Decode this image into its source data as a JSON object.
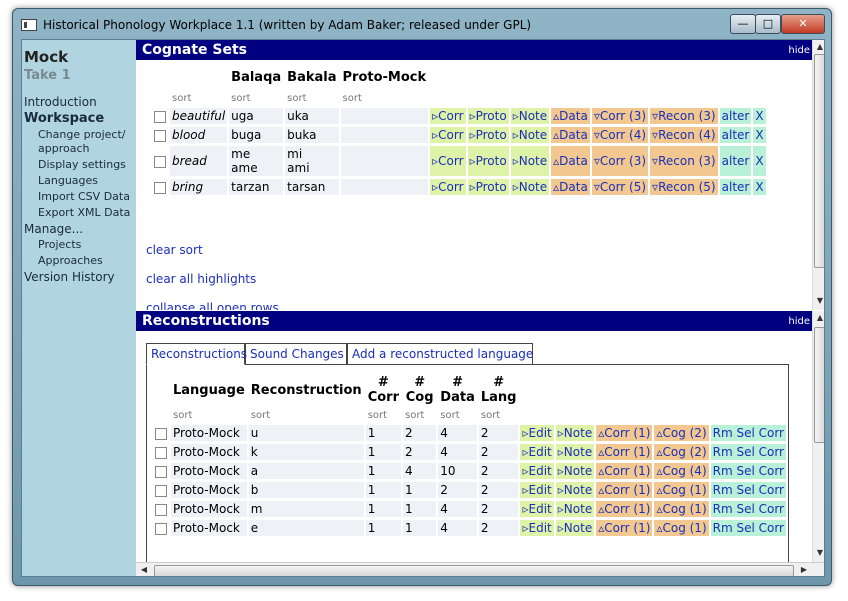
{
  "window": {
    "title": "Historical Phonology Workplace 1.1 (written by Adam Baker; released under GPL)",
    "minimize": "—",
    "maximize": "□",
    "close": "✕"
  },
  "sidebar": {
    "project_name": "Mock",
    "take": "Take 1",
    "introduction": "Introduction",
    "workspace": "Workspace",
    "workspace_items": [
      "Change project/",
      "approach",
      "Display settings",
      "Languages",
      "Import CSV Data",
      "Export XML Data"
    ],
    "manage": "Manage...",
    "manage_items": [
      "Projects",
      "Approaches"
    ],
    "version_history": "Version History"
  },
  "cognate_sets": {
    "header": "Cognate Sets",
    "hide": "hide",
    "columns": [
      "Balaqa",
      "Bakala",
      "Proto-Mock"
    ],
    "sort_label": "sort",
    "rows": [
      {
        "gloss": "beautiful",
        "balaqa": "uga",
        "bakala": "uka",
        "proto": "",
        "corr": "Corr",
        "proto_btn": "Proto",
        "note": "Note",
        "data": "Data",
        "corr_count": "Corr (3)",
        "recon": "Recon (3)",
        "alter": "alter",
        "x": "X"
      },
      {
        "gloss": "blood",
        "balaqa": "buga",
        "bakala": "buka",
        "proto": "",
        "corr": "Corr",
        "proto_btn": "Proto",
        "note": "Note",
        "data": "Data",
        "corr_count": "Corr (4)",
        "recon": "Recon (4)",
        "alter": "alter",
        "x": "X"
      },
      {
        "gloss": "bread",
        "balaqa": "me\name",
        "bakala": "mi\nami",
        "proto": "",
        "corr": "Corr",
        "proto_btn": "Proto",
        "note": "Note",
        "data": "Data",
        "corr_count": "Corr (3)",
        "recon": "Recon (3)",
        "alter": "alter",
        "x": "X"
      },
      {
        "gloss": "bring",
        "balaqa": "tarzan",
        "bakala": "tarsan",
        "proto": "",
        "corr": "Corr",
        "proto_btn": "Proto",
        "note": "Note",
        "data": "Data",
        "corr_count": "Corr (5)",
        "recon": "Recon (5)",
        "alter": "alter",
        "x": "X"
      }
    ],
    "clear_sort": "clear sort",
    "clear_highlights": "clear all highlights",
    "collapse_rows": "collapse all open rows"
  },
  "reconstructions": {
    "header": "Reconstructions",
    "hide": "hide",
    "tabs": [
      "Reconstructions",
      "Sound Changes",
      "Add a reconstructed language"
    ],
    "columns": {
      "language": "Language",
      "reconstruction": "Reconstruction",
      "corr": "#\nCorr",
      "cog": "#\nCog",
      "data": "#\nData",
      "lang": "#\nLang"
    },
    "sort_label": "sort",
    "rows": [
      {
        "language": "Proto-Mock",
        "recon": "u",
        "corr": "1",
        "cog": "2",
        "data": "4",
        "lang": "2",
        "edit": "Edit",
        "note": "Note",
        "corr_btn": "Corr (1)",
        "cog_btn": "Cog (2)",
        "rm": "Rm Sel Corr"
      },
      {
        "language": "Proto-Mock",
        "recon": "k",
        "corr": "1",
        "cog": "2",
        "data": "4",
        "lang": "2",
        "edit": "Edit",
        "note": "Note",
        "corr_btn": "Corr (1)",
        "cog_btn": "Cog (2)",
        "rm": "Rm Sel Corr"
      },
      {
        "language": "Proto-Mock",
        "recon": "a",
        "corr": "1",
        "cog": "4",
        "data": "10",
        "lang": "2",
        "edit": "Edit",
        "note": "Note",
        "corr_btn": "Corr (1)",
        "cog_btn": "Cog (4)",
        "rm": "Rm Sel Corr"
      },
      {
        "language": "Proto-Mock",
        "recon": "b",
        "corr": "1",
        "cog": "1",
        "data": "2",
        "lang": "2",
        "edit": "Edit",
        "note": "Note",
        "corr_btn": "Corr (1)",
        "cog_btn": "Cog (1)",
        "rm": "Rm Sel Corr"
      },
      {
        "language": "Proto-Mock",
        "recon": "m",
        "corr": "1",
        "cog": "1",
        "data": "4",
        "lang": "2",
        "edit": "Edit",
        "note": "Note",
        "corr_btn": "Corr (1)",
        "cog_btn": "Cog (1)",
        "rm": "Rm Sel Corr"
      },
      {
        "language": "Proto-Mock",
        "recon": "e",
        "corr": "1",
        "cog": "1",
        "data": "4",
        "lang": "2",
        "edit": "Edit",
        "note": "Note",
        "corr_btn": "Corr (1)",
        "cog_btn": "Cog (1)",
        "rm": "Rm Sel Corr"
      }
    ]
  },
  "colors": {
    "header_bg": "#000080",
    "sidebar_bg": "#b0d4e0",
    "green_btn": "#dff3a8",
    "orange_btn": "#f2c890",
    "teal_btn": "#b8f0d8",
    "link": "#1a2fb8"
  },
  "icons": {
    "down_triangle": "▿",
    "up_triangle": "▵",
    "right_triangle": "▹"
  }
}
